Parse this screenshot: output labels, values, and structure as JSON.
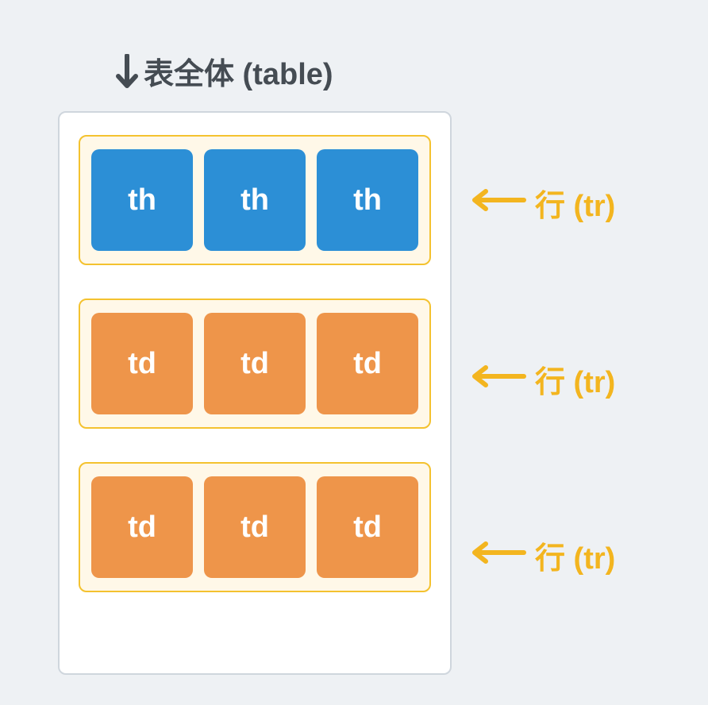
{
  "title": "表全体 (table)",
  "rows": [
    {
      "cells": [
        "th",
        "th",
        "th"
      ],
      "type": "th",
      "label": "行 (tr)"
    },
    {
      "cells": [
        "td",
        "td",
        "td"
      ],
      "type": "td",
      "label": "行 (tr)"
    },
    {
      "cells": [
        "td",
        "td",
        "td"
      ],
      "type": "td",
      "label": "行 (tr)"
    }
  ],
  "colors": {
    "th": "#2c8fd6",
    "td": "#ee954a",
    "row_border": "#f4c22f",
    "row_bg": "#fff8e8",
    "table_border": "#cfd6dd",
    "label": "#f3b51f",
    "title": "#454c53",
    "page_bg": "#eef1f4"
  }
}
